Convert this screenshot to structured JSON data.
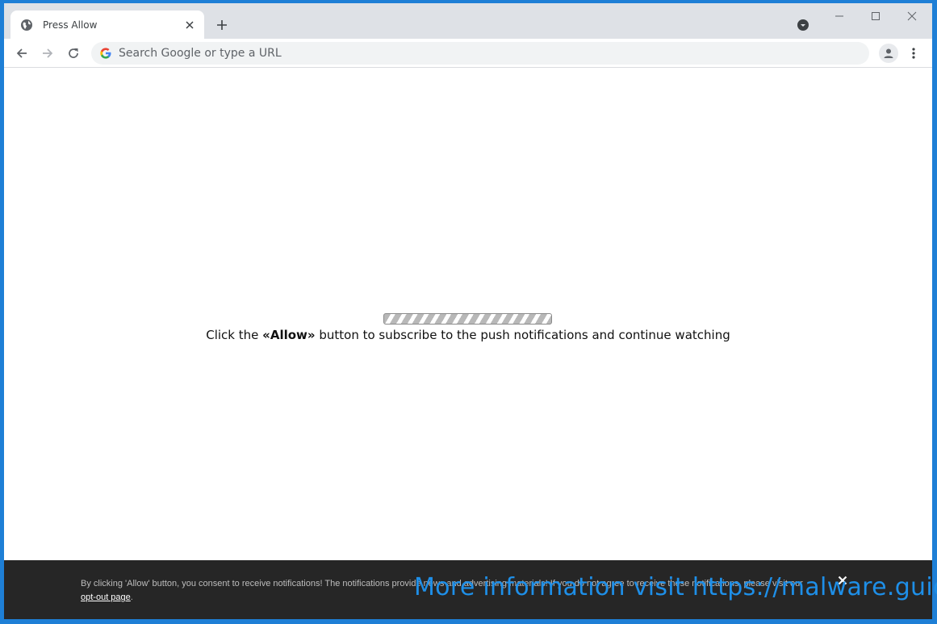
{
  "browser": {
    "tab": {
      "title": "Press Allow"
    },
    "omnibox": {
      "placeholder": "Search Google or type a URL"
    }
  },
  "page": {
    "message_before": "Click the ",
    "message_bold": "«Allow»",
    "message_after": " button to subscribe to the push notifications and continue watching",
    "progress_fraction": 1.0
  },
  "notice": {
    "text": "By clicking 'Allow' button, you consent to receive notifications! The notifications provide news and advertising materials! If you do not agree to receive these notifications, please visit our ",
    "link": "opt-out page",
    "suffix": "."
  },
  "watermark": {
    "text": "More information visit https://malware.guide"
  },
  "colors": {
    "desktop_background": "#1e7fd6",
    "tabstrip": "#dee1e6",
    "notice_bar": "#262626",
    "watermark": "#1e8fe8"
  },
  "icons": [
    "globe-icon",
    "close-icon",
    "plus-icon",
    "tab-search-icon",
    "minimize-icon",
    "maximize-icon",
    "window-close-icon",
    "back-icon",
    "forward-icon",
    "reload-icon",
    "google-icon",
    "profile-icon",
    "menu-icon"
  ]
}
